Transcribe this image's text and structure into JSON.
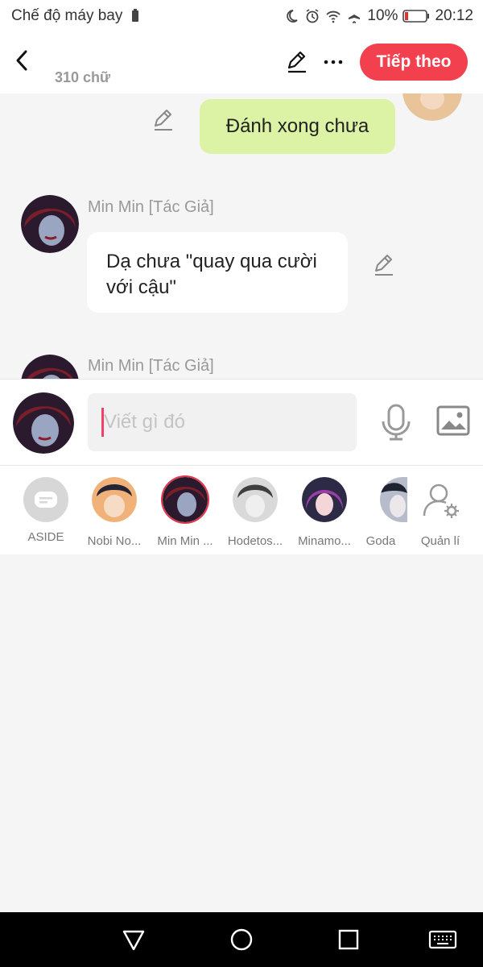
{
  "status_bar": {
    "mode": "Chế độ máy bay",
    "battery_percent": "10%",
    "time": "20:12"
  },
  "top_bar": {
    "word_count": "310 chữ",
    "next_label": "Tiếp theo"
  },
  "chat": {
    "outgoing_text": "Đánh xong chưa",
    "incoming": [
      {
        "name": "Min Min [Tác Giả]",
        "text": "Dạ chưa \"quay qua cười với cậu\""
      },
      {
        "name": "Min Min [Tác Giả]"
      }
    ]
  },
  "input": {
    "placeholder": "Viết gì đó"
  },
  "characters": [
    {
      "label": "ASIDE"
    },
    {
      "label": "Nobi No..."
    },
    {
      "label": "Min Min ..."
    },
    {
      "label": "Hodetos..."
    },
    {
      "label": "Minamo..."
    },
    {
      "label": "Goda"
    },
    {
      "label": "Quản lí"
    }
  ],
  "colors": {
    "accent": "#f2404e",
    "outgoing_bubble": "#dcf2a4",
    "nav_background": "#000000"
  }
}
